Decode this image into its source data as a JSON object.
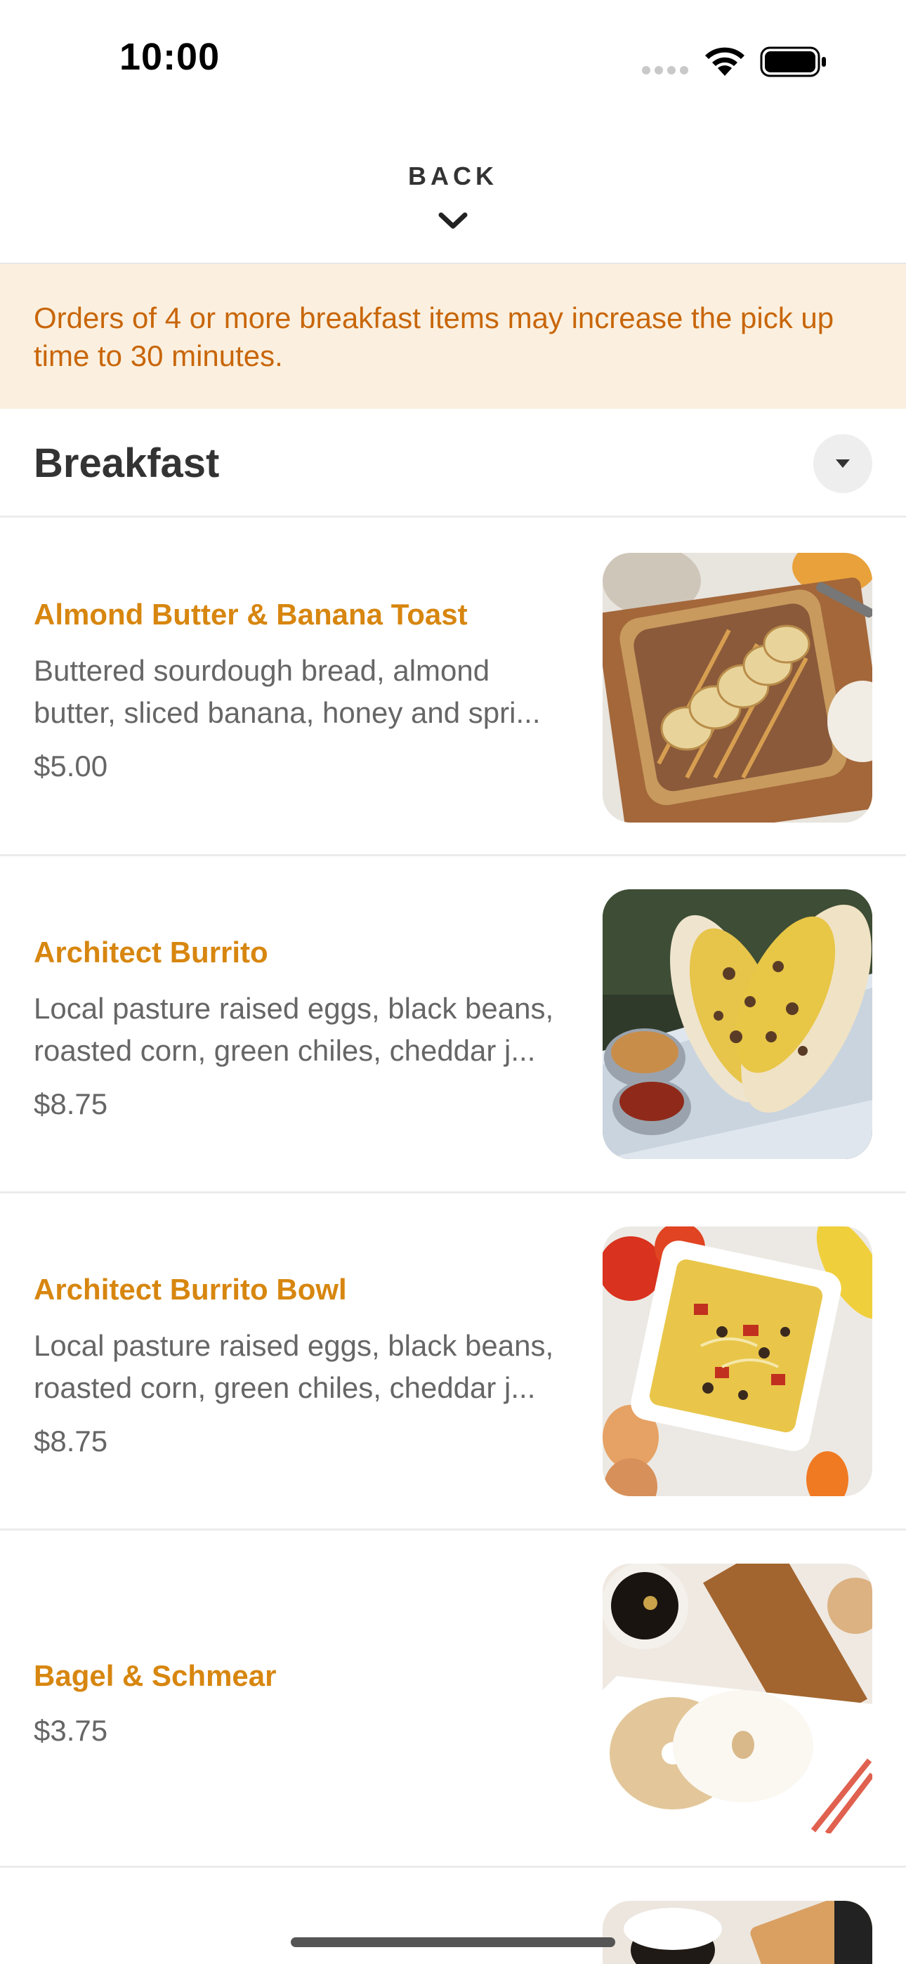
{
  "status_bar": {
    "time": "10:00"
  },
  "nav": {
    "back_label": "BACK"
  },
  "notice": {
    "text": "Orders of 4 or more breakfast items may increase the pick up time to 30 minutes."
  },
  "category": {
    "title": "Breakfast"
  },
  "items": [
    {
      "name": "Almond Butter & Banana Toast",
      "desc_line1": "Buttered sourdough bread, almond",
      "desc_line2": "butter, sliced banana, honey and spri...",
      "price": "$5.00"
    },
    {
      "name": "Architect Burrito",
      "desc_line1": "Local pasture raised eggs, black beans,",
      "desc_line2": "roasted corn, green chiles, cheddar j...",
      "price": "$8.75"
    },
    {
      "name": "Architect Burrito Bowl",
      "desc_line1": "Local pasture raised eggs, black beans,",
      "desc_line2": "roasted corn, green chiles, cheddar j...",
      "price": "$8.75"
    },
    {
      "name": "Bagel & Schmear",
      "price": "$3.75"
    }
  ],
  "colors": {
    "accent": "#d7860f",
    "notice_bg": "#fbf0df",
    "notice_text": "#c8660a",
    "body_text": "#666666",
    "heading": "#333333"
  },
  "icons": {
    "back": "chevron-down-icon",
    "category_toggle": "caret-down-icon",
    "wifi": "wifi-icon",
    "battery": "battery-icon"
  }
}
